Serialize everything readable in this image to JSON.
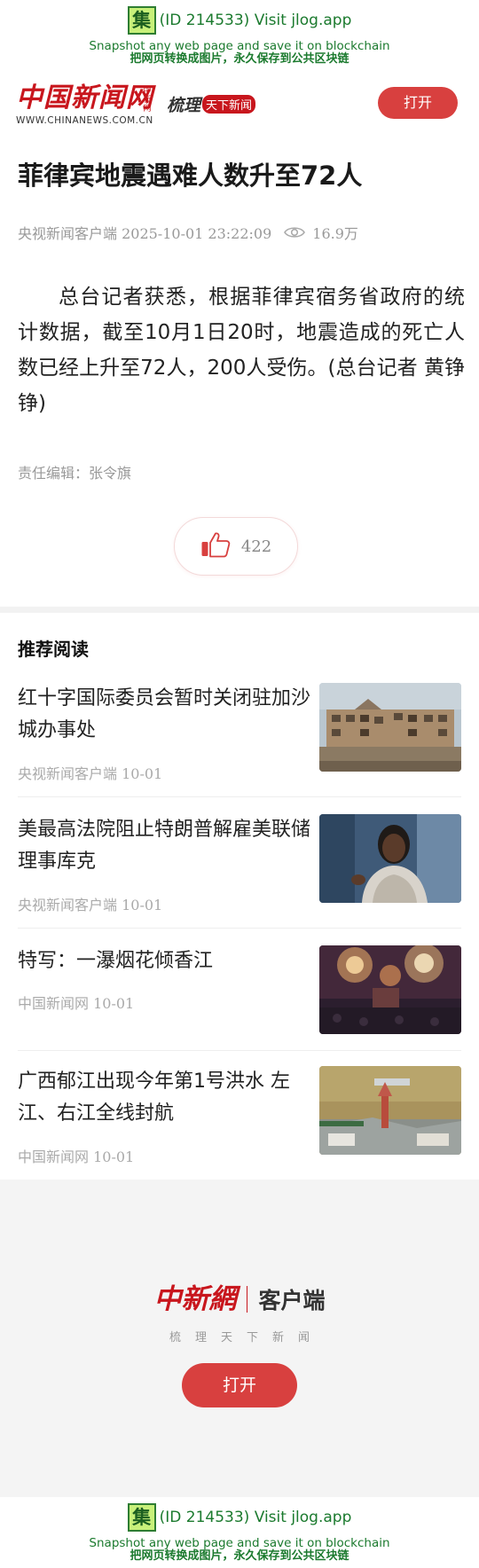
{
  "jlog": {
    "logo_char": "集",
    "id_text": "(ID 214533) Visit jlog.app",
    "tagline_en": "Snapshot any web page and save it on blockchain",
    "tagline_cn": "把网页转换成图片，永久保存到公共区块链"
  },
  "header": {
    "logo_text": "中国新闻网",
    "logo_small": "中新网",
    "logo_url": "WWW.CHINANEWS.COM.CN",
    "slogan_a": "梳理",
    "slogan_b": "天下新闻",
    "open_label": "打开"
  },
  "article": {
    "title": "菲律宾地震遇难人数升至72人",
    "source_time": "央视新闻客户端 2025-10-01 23:22:09",
    "views": "16.9万",
    "body": "总台记者获悉，根据菲律宾宿务省政府的统计数据，截至10月1日20时，地震造成的死亡人数已经上升至72人，200人受伤。(总台记者 黄铮铮)",
    "editor": "责任编辑：张令旗",
    "likes": "422"
  },
  "recommend": {
    "heading": "推荐阅读",
    "items": [
      {
        "title": "红十字国际委员会暂时关闭驻加沙城办事处",
        "meta": "央视新闻客户端 10-01",
        "thumb": "rubble-building-image"
      },
      {
        "title": "美最高法院阻止特朗普解雇美联储理事库克",
        "meta": "央视新闻客户端 10-01",
        "thumb": "woman-speaking-image"
      },
      {
        "title": "特写：一瀑烟花倾香江",
        "meta": "中国新闻网 10-01",
        "thumb": "fireworks-image"
      },
      {
        "title": "广西郁江出现今年第1号洪水 左江、右江全线封航",
        "meta": "中国新闻网 10-01",
        "thumb": "flood-river-image"
      }
    ]
  },
  "promo": {
    "logo_text": "中新網",
    "client_label": "客户端",
    "slogan": "梳理天下新闻",
    "open_label": "打开"
  },
  "colors": {
    "brand_red": "#c8161d",
    "button_red": "#d8403f",
    "jlog_green": "#1b7a2e"
  }
}
